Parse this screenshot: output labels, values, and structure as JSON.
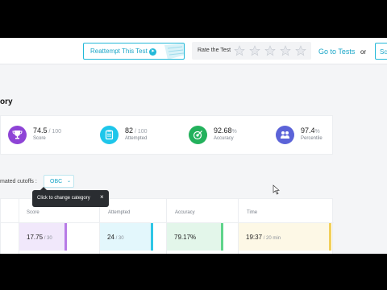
{
  "header": {
    "reattempt_label": "Reattempt This Test",
    "rate_label": "Rate the Test",
    "star_count": 5,
    "goto_label": "Go to Tests",
    "or_label": "or",
    "secondary_button_label": "Sc"
  },
  "section_title": "ory",
  "stats": [
    {
      "value": "74.5",
      "suffix": " / 100",
      "caption": "Score",
      "icon": "trophy-icon",
      "color": "#8e44d6"
    },
    {
      "value": "82",
      "suffix": " / 100",
      "caption": "Attempted",
      "icon": "clipboard-icon",
      "color": "#1ec6ea"
    },
    {
      "value": "92.68",
      "suffix": "%",
      "caption": "Accuracy",
      "icon": "target-icon",
      "color": "#23b15c"
    },
    {
      "value": "97.4",
      "suffix": "%",
      "caption": "Percentile",
      "icon": "users-icon",
      "color": "#5b63d8"
    }
  ],
  "cutoffs": {
    "label": "mated cutoffs :",
    "selected": "OBC",
    "tooltip": "Click to change category"
  },
  "table": {
    "headers": [
      "Score",
      "Attempted",
      "Accuracy",
      "Time"
    ],
    "cells": [
      {
        "value": "17.75",
        "suffix": " / 30",
        "bg": "#f1e8fb",
        "bar": "#b77be6"
      },
      {
        "value": "24",
        "suffix": " / 30",
        "bg": "#e3f7fc",
        "bar": "#2ec6e6"
      },
      {
        "value": "79.17%",
        "suffix": "",
        "bg": "#e3f6ea",
        "bar": "#5fd48b"
      },
      {
        "value": "19:37",
        "suffix": " / 20 min",
        "bg": "#fdf8e6",
        "bar": "#f2cf5b"
      }
    ]
  }
}
